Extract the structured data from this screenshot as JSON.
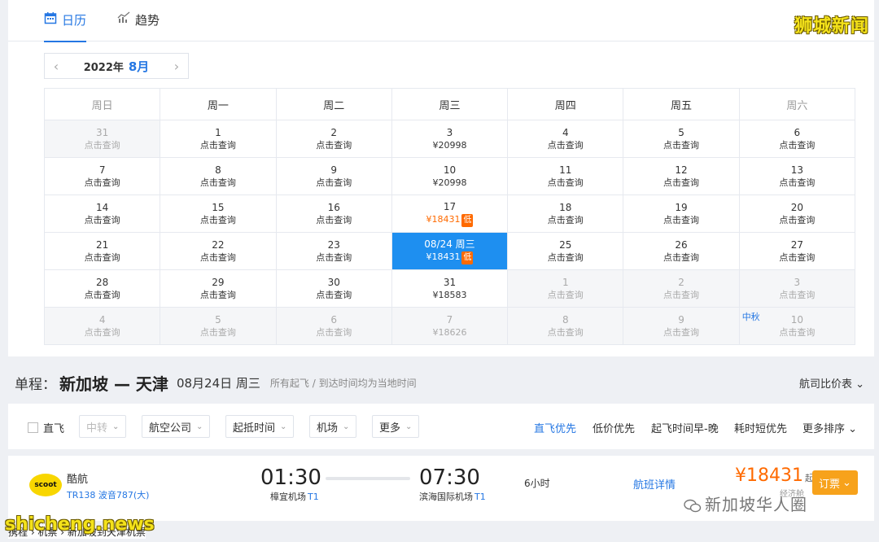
{
  "tabs": {
    "calendar": "日历",
    "trend": "趋势"
  },
  "watermark_top": "狮城新闻",
  "month_nav": {
    "year": "2022年",
    "month": "8月",
    "prev": "‹",
    "next": "›"
  },
  "weekdays": [
    "周日",
    "周一",
    "周二",
    "周三",
    "周四",
    "周五",
    "周六"
  ],
  "calendar": {
    "rows": [
      [
        {
          "d": "31",
          "p": "点击查询",
          "other": true
        },
        {
          "d": "1",
          "p": "点击查询"
        },
        {
          "d": "2",
          "p": "点击查询"
        },
        {
          "d": "3",
          "p": "¥20998"
        },
        {
          "d": "4",
          "p": "点击查询"
        },
        {
          "d": "5",
          "p": "点击查询"
        },
        {
          "d": "6",
          "p": "点击查询"
        }
      ],
      [
        {
          "d": "7",
          "p": "点击查询"
        },
        {
          "d": "8",
          "p": "点击查询"
        },
        {
          "d": "9",
          "p": "点击查询"
        },
        {
          "d": "10",
          "p": "¥20998"
        },
        {
          "d": "11",
          "p": "点击查询"
        },
        {
          "d": "12",
          "p": "点击查询"
        },
        {
          "d": "13",
          "p": "点击查询"
        }
      ],
      [
        {
          "d": "14",
          "p": "点击查询"
        },
        {
          "d": "15",
          "p": "点击查询"
        },
        {
          "d": "16",
          "p": "点击查询"
        },
        {
          "d": "17",
          "p": "¥18431",
          "low": true
        },
        {
          "d": "18",
          "p": "点击查询"
        },
        {
          "d": "19",
          "p": "点击查询"
        },
        {
          "d": "20",
          "p": "点击查询"
        }
      ],
      [
        {
          "d": "21",
          "p": "点击查询"
        },
        {
          "d": "22",
          "p": "点击查询"
        },
        {
          "d": "23",
          "p": "点击查询"
        },
        {
          "d": "08/24 周三",
          "p": "¥18431",
          "low": true,
          "selected": true
        },
        {
          "d": "25",
          "p": "点击查询"
        },
        {
          "d": "26",
          "p": "点击查询"
        },
        {
          "d": "27",
          "p": "点击查询"
        }
      ],
      [
        {
          "d": "28",
          "p": "点击查询"
        },
        {
          "d": "29",
          "p": "点击查询"
        },
        {
          "d": "30",
          "p": "点击查询"
        },
        {
          "d": "31",
          "p": "¥18583"
        },
        {
          "d": "1",
          "p": "点击查询",
          "other": true
        },
        {
          "d": "2",
          "p": "点击查询",
          "other": true
        },
        {
          "d": "3",
          "p": "点击查询",
          "other": true
        }
      ],
      [
        {
          "d": "4",
          "p": "点击查询",
          "other": true
        },
        {
          "d": "5",
          "p": "点击查询",
          "other": true
        },
        {
          "d": "6",
          "p": "点击查询",
          "other": true
        },
        {
          "d": "7",
          "p": "¥18626",
          "other": true
        },
        {
          "d": "8",
          "p": "点击查询",
          "other": true
        },
        {
          "d": "9",
          "p": "点击查询",
          "other": true
        },
        {
          "d": "10",
          "p": "点击查询",
          "other": true,
          "holiday": "中秋"
        }
      ]
    ],
    "low_badge": "低"
  },
  "route": {
    "kind": "单程：",
    "cities": "新加坡 — 天津",
    "date": "08月24日 周三",
    "note": "所有起飞 / 到达时间均为当地时间",
    "compare": "航司比价表"
  },
  "filters": {
    "direct": "直飞",
    "buttons": [
      "中转",
      "航空公司",
      "起抵时间",
      "机场",
      "更多"
    ],
    "sorts": [
      "直飞优先",
      "低价优先",
      "起飞时间早-晚",
      "耗时短优先",
      "更多排序"
    ]
  },
  "flight": {
    "logo_text": "scoot",
    "airline": "酷航",
    "flight_no": "TR138 波音787(大)",
    "dep_time": "01:30",
    "dep_airport": "樟宜机场",
    "dep_terminal": "T1",
    "arr_time": "07:30",
    "arr_airport": "滨海国际机场",
    "arr_terminal": "T1",
    "duration": "6小时",
    "details": "航班详情",
    "price": "¥18431",
    "price_suffix": "起",
    "price_sub": "经济舱",
    "book": "订票"
  },
  "watermark_wechat": "新加坡华人圈",
  "watermark_site": "shicheng.news",
  "breadcrumb": "携程 › 机票 › 新加坡到天津机票",
  "colors": {
    "accent": "#2577e3",
    "selected": "#1e8ff0",
    "price": "#ff6a00",
    "book": "#f7a21b"
  }
}
